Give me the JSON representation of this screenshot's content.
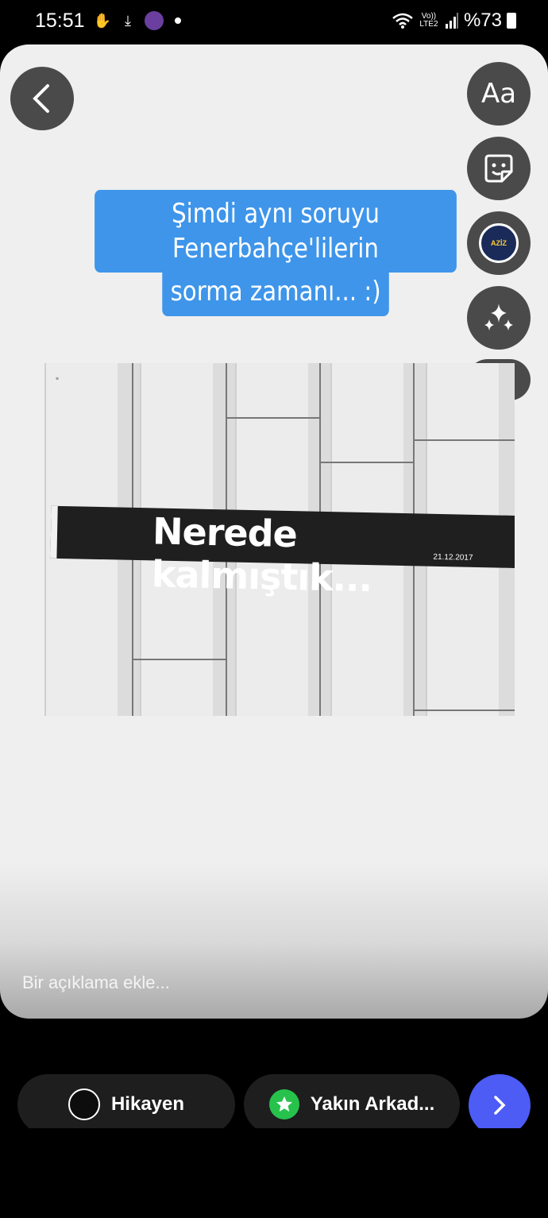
{
  "status_bar": {
    "time": "15:51",
    "network": "Vo)) LTE2",
    "battery": "%73"
  },
  "editor": {
    "text_tool_label": "Aa",
    "caption_lines": [
      "Şimdi aynı soruyu Fenerbahçe'lilerin",
      "sorma zamanı... :)"
    ],
    "avatar_sticker_text": "AZİZ",
    "description_placeholder": "Bir açıklama ekle..."
  },
  "photo": {
    "scarf_text": "Nerede kalmıştık...",
    "scarf_date": "21.12.2017"
  },
  "share_bar": {
    "story_label": "Hikayen",
    "close_friends_label": "Yakın Arkad..."
  }
}
